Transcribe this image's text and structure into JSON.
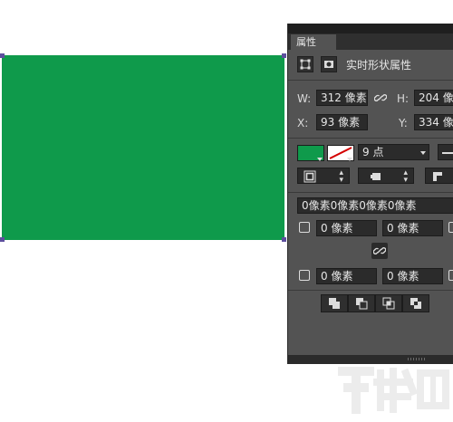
{
  "panel": {
    "tab_label": "属性",
    "title": "实时形状属性",
    "w_label": "W:",
    "w_value": "312 像素",
    "h_label": "H:",
    "h_value": "204 像素",
    "x_label": "X:",
    "x_value": "93 像素",
    "y_label": "Y:",
    "y_value": "334 像素",
    "stroke_width_value": "9 点",
    "corner_radius_all": "0像素0像素0像素0像素",
    "corner_tl": "0 像素",
    "corner_tr": "0 像素",
    "corner_bl": "0 像素",
    "corner_br": "0 像素",
    "fill_color": "#0f9a4b"
  },
  "canvas": {
    "shape_color": "#0f9a4b"
  },
  "icons": {
    "transform": "shape-transform-icon",
    "mask": "mask-icon",
    "link": "link-icon"
  }
}
